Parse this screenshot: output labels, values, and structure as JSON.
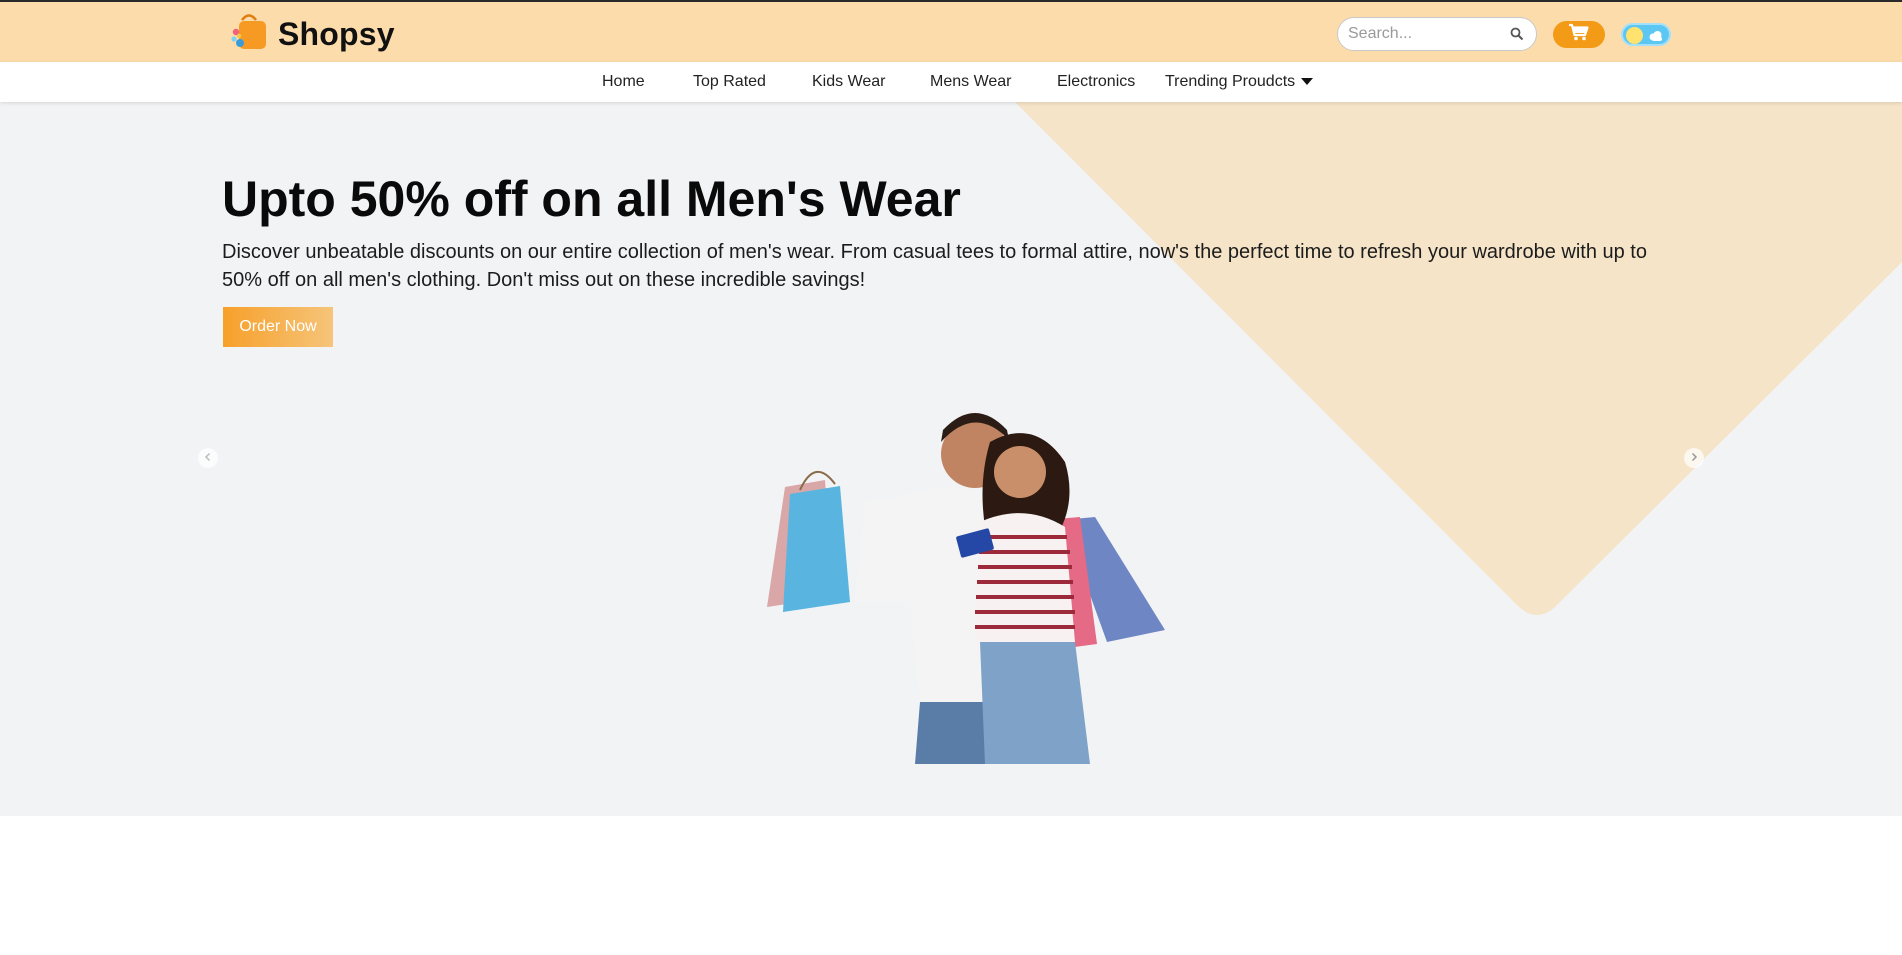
{
  "header": {
    "brand": "Shopsy",
    "search": {
      "placeholder": "Search...",
      "value": ""
    },
    "icons": [
      "shopping-bag-logo-icon",
      "search-icon",
      "cart-icon",
      "theme-toggle"
    ],
    "colors": {
      "topbar": "#fddcab",
      "accent": "#f39a16",
      "toggle": "#5cc7f2"
    }
  },
  "nav": {
    "items": [
      {
        "label": "Home"
      },
      {
        "label": "Top Rated"
      },
      {
        "label": "Kids Wear"
      },
      {
        "label": "Mens Wear"
      },
      {
        "label": "Electronics"
      },
      {
        "label": "Trending Proudcts"
      }
    ]
  },
  "hero": {
    "title": "Upto 50% off on all Men's Wear",
    "description": "Discover unbeatable discounts on our entire collection of men's wear. From casual tees to formal attire, now's the perfect time to refresh your wardrobe with up to 50% off on all men's clothing. Don't miss out on these incredible savings!",
    "cta_label": "Order Now",
    "colors": {
      "background": "#f2f3f5",
      "shape": "#f6e4c8",
      "cta": "#f7a02a"
    }
  }
}
